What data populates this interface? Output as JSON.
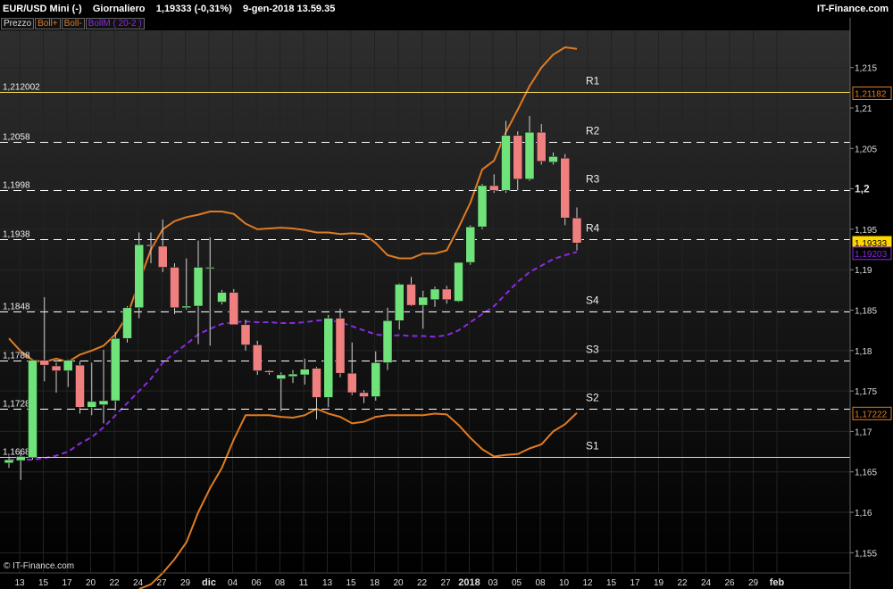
{
  "header": {
    "symbol": "EUR/USD Mini (-)",
    "period": "Giornaliero",
    "last": "1,19333 (-0,31%)",
    "datetime": "9-gen-2018 13.59.35",
    "brand": "IT-Finance.com"
  },
  "legend": {
    "items": [
      {
        "label": "Prezzo",
        "color": "#dddddd"
      },
      {
        "label": "Boll+",
        "color": "#e07b22"
      },
      {
        "label": "Boll-",
        "color": "#e07b22"
      },
      {
        "label": "BollM ( 20-2 )",
        "color": "#8a2be2"
      }
    ]
  },
  "watermark": "© IT-Finance.com",
  "chart_data": {
    "type": "candlestick",
    "x_ticks": [
      "13",
      "15",
      "17",
      "20",
      "22",
      "24",
      "27",
      "29",
      "dic",
      "04",
      "06",
      "08",
      "11",
      "13",
      "15",
      "18",
      "20",
      "22",
      "27",
      "2018",
      "03",
      "05",
      "08",
      "10",
      "12",
      "15",
      "17",
      "19",
      "22",
      "24",
      "26",
      "29",
      "feb"
    ],
    "y_ticks": [
      "1,215",
      "1,21",
      "1,205",
      "1,2",
      "1,195",
      "1,19",
      "1,185",
      "1,18",
      "1,175",
      "1,17",
      "1,165",
      "1,16",
      "1,155"
    ],
    "ylim": [
      1.1525,
      1.2196
    ],
    "colors": {
      "up": "#6fe27a",
      "down": "#f08080",
      "upper_band": "#e07b22",
      "lower_band": "#e07b22",
      "middle_band": "#8a2be2",
      "level_line": "#ffffff",
      "hline": "#ffe060"
    },
    "candles": [
      {
        "o": 1.1661,
        "h": 1.1669,
        "l": 1.1655,
        "c": 1.1665
      },
      {
        "o": 1.1664,
        "h": 1.1677,
        "l": 1.164,
        "c": 1.1669
      },
      {
        "o": 1.1668,
        "h": 1.1789,
        "l": 1.1665,
        "c": 1.1788
      },
      {
        "o": 1.1788,
        "h": 1.1866,
        "l": 1.1762,
        "c": 1.1782
      },
      {
        "o": 1.1781,
        "h": 1.1785,
        "l": 1.1748,
        "c": 1.1775
      },
      {
        "o": 1.1775,
        "h": 1.1789,
        "l": 1.1755,
        "c": 1.1788
      },
      {
        "o": 1.1782,
        "h": 1.1787,
        "l": 1.1722,
        "c": 1.173
      },
      {
        "o": 1.173,
        "h": 1.1785,
        "l": 1.172,
        "c": 1.1737
      },
      {
        "o": 1.1733,
        "h": 1.1801,
        "l": 1.171,
        "c": 1.1738
      },
      {
        "o": 1.1738,
        "h": 1.1823,
        "l": 1.1726,
        "c": 1.1815
      },
      {
        "o": 1.1815,
        "h": 1.1855,
        "l": 1.181,
        "c": 1.1853
      },
      {
        "o": 1.1853,
        "h": 1.1946,
        "l": 1.184,
        "c": 1.1931
      },
      {
        "o": 1.1931,
        "h": 1.1946,
        "l": 1.1908,
        "c": 1.1929
      },
      {
        "o": 1.1929,
        "h": 1.1962,
        "l": 1.1897,
        "c": 1.1903
      },
      {
        "o": 1.1903,
        "h": 1.1908,
        "l": 1.1845,
        "c": 1.1853
      },
      {
        "o": 1.1853,
        "h": 1.1914,
        "l": 1.1851,
        "c": 1.1855
      },
      {
        "o": 1.1855,
        "h": 1.1936,
        "l": 1.1808,
        "c": 1.1903
      },
      {
        "o": 1.1903,
        "h": 1.194,
        "l": 1.1806,
        "c": 1.1903
      },
      {
        "o": 1.186,
        "h": 1.1875,
        "l": 1.1857,
        "c": 1.1872
      },
      {
        "o": 1.1872,
        "h": 1.1876,
        "l": 1.1845,
        "c": 1.1832
      },
      {
        "o": 1.1832,
        "h": 1.1838,
        "l": 1.18,
        "c": 1.1807
      },
      {
        "o": 1.1807,
        "h": 1.1812,
        "l": 1.177,
        "c": 1.1775
      },
      {
        "o": 1.1775,
        "h": 1.1776,
        "l": 1.177,
        "c": 1.1773
      },
      {
        "o": 1.1765,
        "h": 1.1773,
        "l": 1.1725,
        "c": 1.177
      },
      {
        "o": 1.1768,
        "h": 1.1776,
        "l": 1.176,
        "c": 1.1771
      },
      {
        "o": 1.177,
        "h": 1.179,
        "l": 1.1758,
        "c": 1.1777
      },
      {
        "o": 1.1778,
        "h": 1.178,
        "l": 1.1715,
        "c": 1.1742
      },
      {
        "o": 1.1742,
        "h": 1.1844,
        "l": 1.173,
        "c": 1.184
      },
      {
        "o": 1.184,
        "h": 1.1852,
        "l": 1.1767,
        "c": 1.1772
      },
      {
        "o": 1.1772,
        "h": 1.181,
        "l": 1.1745,
        "c": 1.1748
      },
      {
        "o": 1.1748,
        "h": 1.1751,
        "l": 1.1735,
        "c": 1.1743
      },
      {
        "o": 1.1743,
        "h": 1.1799,
        "l": 1.1738,
        "c": 1.1785
      },
      {
        "o": 1.1785,
        "h": 1.1853,
        "l": 1.1776,
        "c": 1.1837
      },
      {
        "o": 1.1837,
        "h": 1.1883,
        "l": 1.1826,
        "c": 1.1882
      },
      {
        "o": 1.1882,
        "h": 1.1891,
        "l": 1.1855,
        "c": 1.1856
      },
      {
        "o": 1.1856,
        "h": 1.1874,
        "l": 1.1827,
        "c": 1.1866
      },
      {
        "o": 1.1863,
        "h": 1.1879,
        "l": 1.1854,
        "c": 1.1876
      },
      {
        "o": 1.1876,
        "h": 1.188,
        "l": 1.1858,
        "c": 1.1863
      },
      {
        "o": 1.1861,
        "h": 1.1909,
        "l": 1.186,
        "c": 1.1909
      },
      {
        "o": 1.1909,
        "h": 1.1955,
        "l": 1.1906,
        "c": 1.1953
      },
      {
        "o": 1.1953,
        "h": 1.2006,
        "l": 1.195,
        "c": 1.2004
      },
      {
        "o": 1.2004,
        "h": 1.2018,
        "l": 1.1995,
        "c": 1.1998
      },
      {
        "o": 1.1998,
        "h": 1.2084,
        "l": 1.1995,
        "c": 1.2066
      },
      {
        "o": 1.2066,
        "h": 1.2071,
        "l": 1.1998,
        "c": 1.2012
      },
      {
        "o": 1.2012,
        "h": 1.209,
        "l": 1.201,
        "c": 1.207
      },
      {
        "o": 1.207,
        "h": 1.208,
        "l": 1.203,
        "c": 1.2034
      },
      {
        "o": 1.2033,
        "h": 1.2045,
        "l": 1.203,
        "c": 1.204
      },
      {
        "o": 1.2038,
        "h": 1.2043,
        "l": 1.1955,
        "c": 1.1964
      },
      {
        "o": 1.1964,
        "h": 1.1977,
        "l": 1.1924,
        "c": 1.1933
      }
    ],
    "upper_band": [
      1.1815,
      1.1799,
      1.1788,
      1.1786,
      1.179,
      1.1786,
      1.1795,
      1.18,
      1.1806,
      1.182,
      1.1843,
      1.1885,
      1.1925,
      1.195,
      1.196,
      1.1965,
      1.1968,
      1.1972,
      1.1972,
      1.1969,
      1.1957,
      1.195,
      1.1951,
      1.1952,
      1.1951,
      1.1949,
      1.1946,
      1.1946,
      1.1944,
      1.1945,
      1.1944,
      1.1933,
      1.1918,
      1.1914,
      1.1914,
      1.192,
      1.192,
      1.1924,
      1.1952,
      1.1983,
      1.2024,
      1.2035,
      1.207,
      1.2098,
      1.2127,
      1.215,
      1.2166,
      1.2175,
      1.2173
    ],
    "lower_band": [
      null,
      null,
      null,
      null,
      null,
      null,
      null,
      null,
      null,
      null,
      null,
      1.1505,
      1.1511,
      1.1525,
      1.1542,
      1.1563,
      1.16,
      1.163,
      1.1655,
      1.169,
      1.172,
      1.172,
      1.172,
      1.1718,
      1.1717,
      1.172,
      1.1728,
      1.1722,
      1.1718,
      1.171,
      1.1712,
      1.1718,
      1.172,
      1.172,
      1.172,
      1.172,
      1.1722,
      1.1721,
      1.1708,
      1.1692,
      1.1678,
      1.1669,
      1.1671,
      1.1672,
      1.1679,
      1.1684,
      1.17,
      1.1709,
      1.1723
    ],
    "middle_band": [
      1.1665,
      1.1665,
      1.1665,
      1.1667,
      1.167,
      1.1675,
      1.1685,
      1.1693,
      1.1705,
      1.172,
      1.1735,
      1.175,
      1.1765,
      1.1785,
      1.1797,
      1.1808,
      1.182,
      1.1827,
      1.1833,
      1.1835,
      1.1836,
      1.1835,
      1.1835,
      1.1834,
      1.1834,
      1.1835,
      1.1837,
      1.1838,
      1.1835,
      1.183,
      1.1825,
      1.182,
      1.1818,
      1.1819,
      1.1818,
      1.1818,
      1.1817,
      1.1819,
      1.1825,
      1.1835,
      1.1845,
      1.1855,
      1.187,
      1.1885,
      1.1897,
      1.1905,
      1.1913,
      1.1918,
      1.1922
    ],
    "resistance_levels": [
      {
        "label": "R1",
        "value": 1.212002,
        "price_label": "1,212002",
        "style": "solid"
      },
      {
        "label": "R2",
        "value": 1.2058,
        "price_label": "1,2058",
        "style": "dashed"
      },
      {
        "label": "R3",
        "value": 1.1998,
        "price_label": "1,1998",
        "style": "dashed"
      },
      {
        "label": "R4",
        "value": 1.1938,
        "price_label": "1,1938",
        "style": "dashed"
      }
    ],
    "support_levels": [
      {
        "label": "S4",
        "value": 1.1848,
        "price_label": "1,1848",
        "style": "dashed"
      },
      {
        "label": "S3",
        "value": 1.1788,
        "price_label": "1,1788",
        "style": "dashed"
      },
      {
        "label": "S2",
        "value": 1.1728,
        "price_label": "1,1728",
        "style": "dashed"
      },
      {
        "label": "S1",
        "value": 1.1668,
        "price_label": "1,16681",
        "style": "solid"
      }
    ],
    "axis_badges": [
      {
        "value": 1.21182,
        "label": "1,21182",
        "border": "#e07b22",
        "bg": "#000000",
        "fg": "#e07b22"
      },
      {
        "value": 1.19333,
        "label": "1,19333",
        "border": "#ffd700",
        "bg": "#ffd700",
        "fg": "#000000"
      },
      {
        "value": 1.19203,
        "label": "1,19203",
        "border": "#8a2be2",
        "bg": "#000000",
        "fg": "#8a2be2"
      },
      {
        "value": 1.17222,
        "label": "1,17222",
        "border": "#e07b22",
        "bg": "#000000",
        "fg": "#e07b22"
      }
    ]
  }
}
